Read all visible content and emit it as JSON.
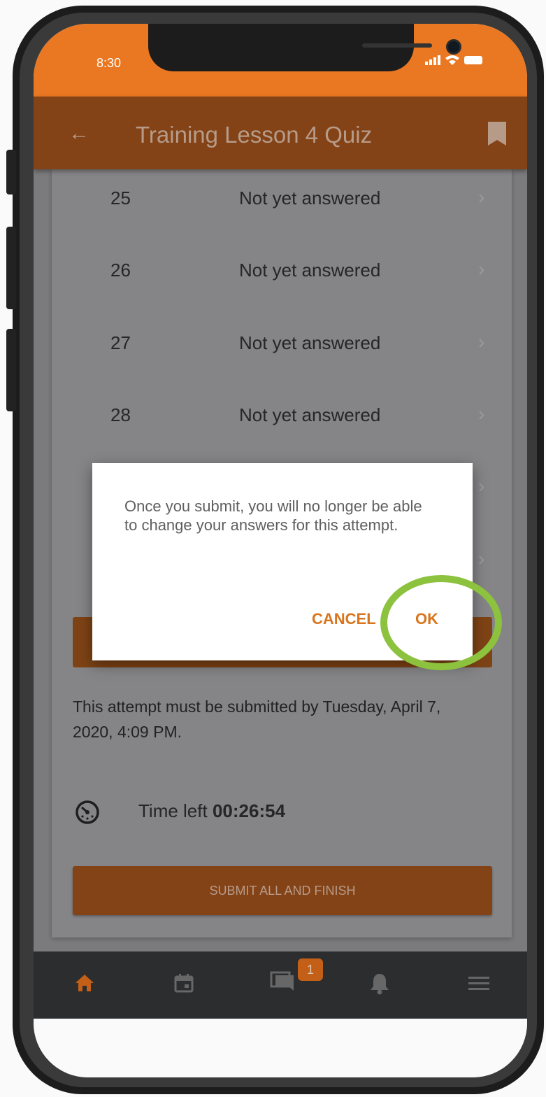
{
  "status_bar": {
    "time": "8:30"
  },
  "app_bar": {
    "title": "Training Lesson 4 Quiz",
    "back_icon": "arrow-left-icon",
    "bookmark_icon": "bookmark-icon"
  },
  "questions": [
    {
      "number": "25",
      "status": "Not yet answered"
    },
    {
      "number": "26",
      "status": "Not yet answered"
    },
    {
      "number": "27",
      "status": "Not yet answered"
    },
    {
      "number": "28",
      "status": "Not yet answered"
    }
  ],
  "attempt": {
    "deadline_text": "This attempt must be submitted by Tuesday, April 7, 2020, 4:09 PM.",
    "time_left_label": "Time left",
    "time_left_value": "00:26:54"
  },
  "submit_button": {
    "label": "SUBMIT ALL AND FINISH"
  },
  "dialog": {
    "message": "Once you submit, you will no longer be able to change your answers for this attempt.",
    "cancel_label": "CANCEL",
    "ok_label": "OK"
  },
  "bottom_nav": {
    "items": [
      "home-icon",
      "calendar-icon",
      "messages-icon",
      "notifications-icon",
      "menu-icon"
    ],
    "messages_badge": "1"
  },
  "colors": {
    "status_bar": "#ea7822",
    "app_bar": "#834317",
    "accent": "#d9751e",
    "highlight": "#8cc23e",
    "nav_bar": "#2b2d2f"
  }
}
